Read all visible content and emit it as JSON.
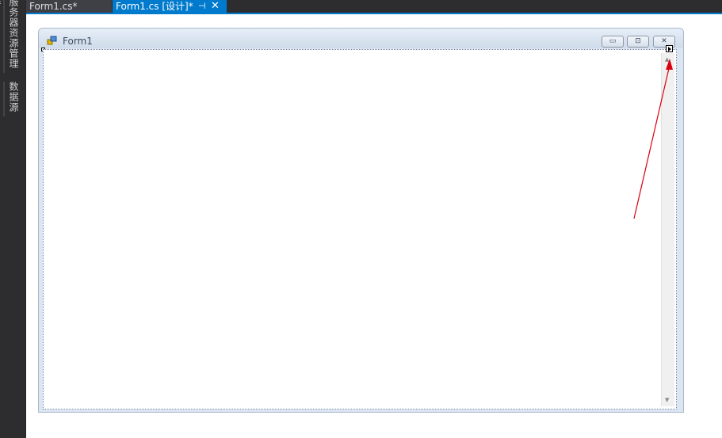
{
  "side_panel": {
    "tabs": [
      "服务器资源管理器",
      "数据源"
    ]
  },
  "document_tabs": [
    {
      "label": "Form1.cs*",
      "active": false
    },
    {
      "label": "Form1.cs [设计]*",
      "active": true
    }
  ],
  "tab_icons": {
    "pin": "pin-icon",
    "close": "close-icon"
  },
  "form": {
    "title": "Form1",
    "icon": "form-icon",
    "caption_buttons": [
      "minimize-icon",
      "maximize-icon",
      "close-icon"
    ]
  },
  "colors": {
    "accent": "#007acc",
    "annotation_arrow": "#d9000d",
    "ide_background": "#2d2d30"
  }
}
